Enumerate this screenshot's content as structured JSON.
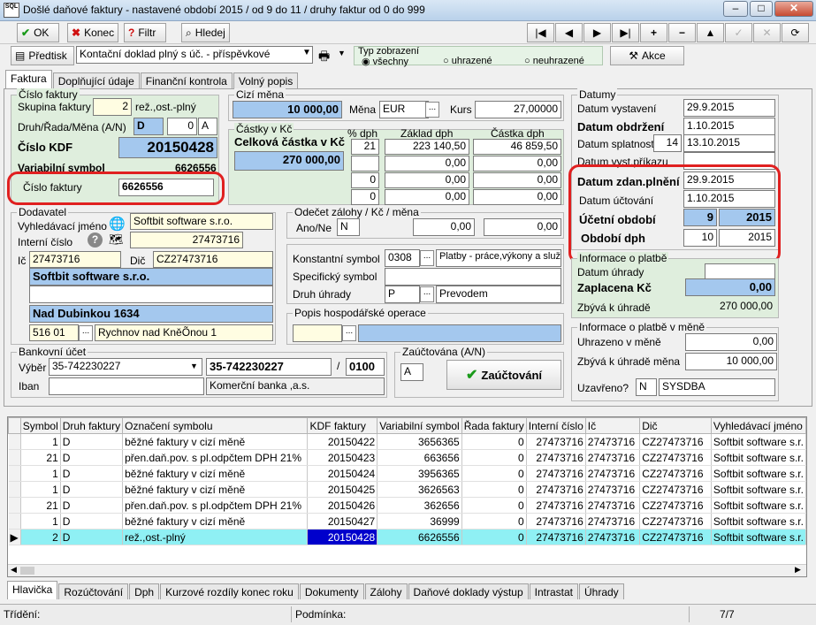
{
  "window": {
    "title": "Došlé daňové faktury - nastavené období 2015 / od 9 do 11 / druhy faktur od 0 do 999",
    "icon_text": "SQL"
  },
  "toolbar": {
    "ok": "OK",
    "konec": "Konec",
    "filtr": "Filtr",
    "hledej": "Hledej",
    "nav": [
      "|◀",
      "◀",
      "▶",
      "▶|",
      "+",
      "−",
      "▲",
      "✓",
      "✕",
      "⟳"
    ]
  },
  "row2": {
    "predtisk": "Předtisk",
    "kontace": "Kontační doklad plný s úč. - příspěvkové",
    "typ_zobrazeni": "Typ zobrazení",
    "opt1": "všechny",
    "opt2": "uhrazené",
    "opt3": "neuhrazené",
    "akce": "Akce"
  },
  "tabs_top": [
    "Faktura",
    "Doplňující údaje",
    "Finanční kontrola",
    "Volný popis"
  ],
  "cislo_faktury": {
    "group_title": "Číslo faktury",
    "skupina_label": "Skupina faktury",
    "skupina_value": "2",
    "skupina_text": "rež.,ost.-plný",
    "druh_label": "Druh/Řada/Měna (A/N)",
    "druh": "D",
    "rada": "0",
    "mena": "A",
    "kdf_label": "Číslo KDF",
    "kdf": "20150428",
    "vs_label": "Variabilní symbol",
    "vs": "6626556",
    "cf_label": "Číslo faktury",
    "cf": "6626556"
  },
  "cizi_mena": {
    "group_title": "Cizí měna",
    "amount": "10 000,00",
    "mena_label": "Měna",
    "mena": "EUR",
    "kurs_label": "Kurs",
    "kurs": "27,00000"
  },
  "castky": {
    "group_title": "Částky v Kč",
    "celkova_label": "Celková částka v Kč",
    "celkova": "270 000,00",
    "h_dph": "% dph",
    "h_zaklad": "Základ dph",
    "h_castka": "Částka dph",
    "rows": [
      {
        "dph": "21",
        "zaklad": "223 140,50",
        "castka": "46 859,50"
      },
      {
        "dph": "",
        "zaklad": "0,00",
        "castka": "0,00"
      },
      {
        "dph": "0",
        "zaklad": "0,00",
        "castka": "0,00"
      },
      {
        "dph": "0",
        "zaklad": "0,00",
        "castka": "0,00"
      }
    ]
  },
  "datumy": {
    "group_title": "Datumy",
    "vystaveni_label": "Datum vystavení",
    "vystaveni": "29.9.2015",
    "obdrzeni_label": "Datum obdržení",
    "obdrzeni": "1.10.2015",
    "splatnosti_label": "Datum splatnosti",
    "splatnosti_days": "14",
    "splatnosti": "13.10.2015",
    "vyst_prikazu_label": "Datum vyst.příkazu",
    "vyst_prikazu": "",
    "zdan_label": "Datum zdan.plnění",
    "zdan": "29.9.2015",
    "uctovani_label": "Datum účtování",
    "uctovani": "1.10.2015",
    "ucetni_label": "Účetní období",
    "ucetni_mesic": "9",
    "ucetni_rok": "2015",
    "obdobi_dph_label": "Období dph",
    "obdobi_dph_mesic": "10",
    "obdobi_dph_rok": "2015"
  },
  "dodavatel": {
    "group_title": "Dodavatel",
    "vyhl_label": "Vyhledávací jméno",
    "vyhl": "Softbit software s.r.o.",
    "interni_label": "Interní číslo",
    "interni": "27473716",
    "ic_label": "Ič",
    "ic": "27473716",
    "dic_label": "Dič",
    "dic": "CZ27473716",
    "nazev": "Softbit software s.r.o.",
    "ulice": "Nad Dubinkou 1634",
    "psc": "516 01",
    "mesto": "Rychnov nad KněÕnou 1"
  },
  "odecet": {
    "group_title": "Odečet zálohy / Kč / měna",
    "ano_ne_label": "Ano/Ne",
    "ano_ne": "N",
    "kc": "0,00",
    "mena": "0,00"
  },
  "symboly": {
    "konst_label": "Konstantní symbol",
    "konst": "0308",
    "konst_text": "Platby - práce,výkony a služby",
    "spec_label": "Specifický symbol",
    "spec": "",
    "druh_uhrady_label": "Druh úhrady",
    "druh_uhrady": "P",
    "druh_uhrady_text": "Prevodem"
  },
  "popis": {
    "group_title": "Popis hospodářské operace",
    "code": "",
    "text": ""
  },
  "platba_kc": {
    "group_title": "Informace o platbě",
    "datum_uhrady_label": "Datum úhrady",
    "datum_uhrady": "",
    "zaplacena_label": "Zaplacena Kč",
    "zaplacena": "0,00",
    "zbyva_label": "Zbývá k úhradě",
    "zbyva": "270 000,00"
  },
  "platba_mena": {
    "group_title": "Informace o platbě v měně",
    "uhrazeno_label": "Uhrazeno v měně",
    "uhrazeno": "0,00",
    "zbyva_label": "Zbývá k úhradě měna",
    "zbyva": "10 000,00",
    "uzavreno_label": "Uzavřeno?",
    "uzavreno": "N",
    "uzivatel": "SYSDBA"
  },
  "bank": {
    "group_title": "Bankovní účet",
    "vyber_label": "Výběr",
    "vyber": "35-742230227",
    "ucet": "35-742230227",
    "slash": "/",
    "kod": "0100",
    "iban_label": "Iban",
    "iban": "",
    "banka": "Komerční banka ,a.s."
  },
  "zauct": {
    "group_title": "Zaúčtována (A/N)",
    "value": "A",
    "button": "Zaúčtování"
  },
  "grid": {
    "columns": [
      "Symbol",
      "Druh faktury",
      "Označení symbolu",
      "KDF faktury",
      "Variabilní symbol",
      "Řada faktury",
      "Interní číslo",
      "Ič",
      "Dič",
      "Vyhledávací jméno"
    ],
    "rows": [
      [
        "1",
        "D",
        "běžné faktury v cizí měně",
        "20150422",
        "3656365",
        "0",
        "27473716",
        "27473716",
        "CZ27473716",
        "Softbit software s.r."
      ],
      [
        "21",
        "D",
        "přen.daň.pov. s pl.odpčtem DPH 21%",
        "20150423",
        "663656",
        "0",
        "27473716",
        "27473716",
        "CZ27473716",
        "Softbit software s.r."
      ],
      [
        "1",
        "D",
        "běžné faktury v cizí měně",
        "20150424",
        "3956365",
        "0",
        "27473716",
        "27473716",
        "CZ27473716",
        "Softbit software s.r."
      ],
      [
        "1",
        "D",
        "běžné faktury v cizí měně",
        "20150425",
        "3626563",
        "0",
        "27473716",
        "27473716",
        "CZ27473716",
        "Softbit software s.r."
      ],
      [
        "21",
        "D",
        "přen.daň.pov. s pl.odpčtem DPH 21%",
        "20150426",
        "362656",
        "0",
        "27473716",
        "27473716",
        "CZ27473716",
        "Softbit software s.r."
      ],
      [
        "1",
        "D",
        "běžné faktury v cizí měně",
        "20150427",
        "36999",
        "0",
        "27473716",
        "27473716",
        "CZ27473716",
        "Softbit software s.r."
      ],
      [
        "2",
        "D",
        "rež.,ost.-plný",
        "20150428",
        "6626556",
        "0",
        "27473716",
        "27473716",
        "CZ27473716",
        "Softbit software s.r."
      ]
    ]
  },
  "tabs_bottom": [
    "Hlavička",
    "Rozúčtování",
    "Dph",
    "Kurzové rozdíly konec roku",
    "Dokumenty",
    "Zálohy",
    "Daňové doklady výstup",
    "Intrastat",
    "Úhrady"
  ],
  "status": {
    "trideni": "Třídění:",
    "podminka": "Podmínka:",
    "pocet": "7/7"
  },
  "colors": {
    "accent_blue": "#a4c8ee",
    "green_panel": "#dfeedd",
    "yellow_field": "#fffde2",
    "highlight": "#e02020"
  }
}
